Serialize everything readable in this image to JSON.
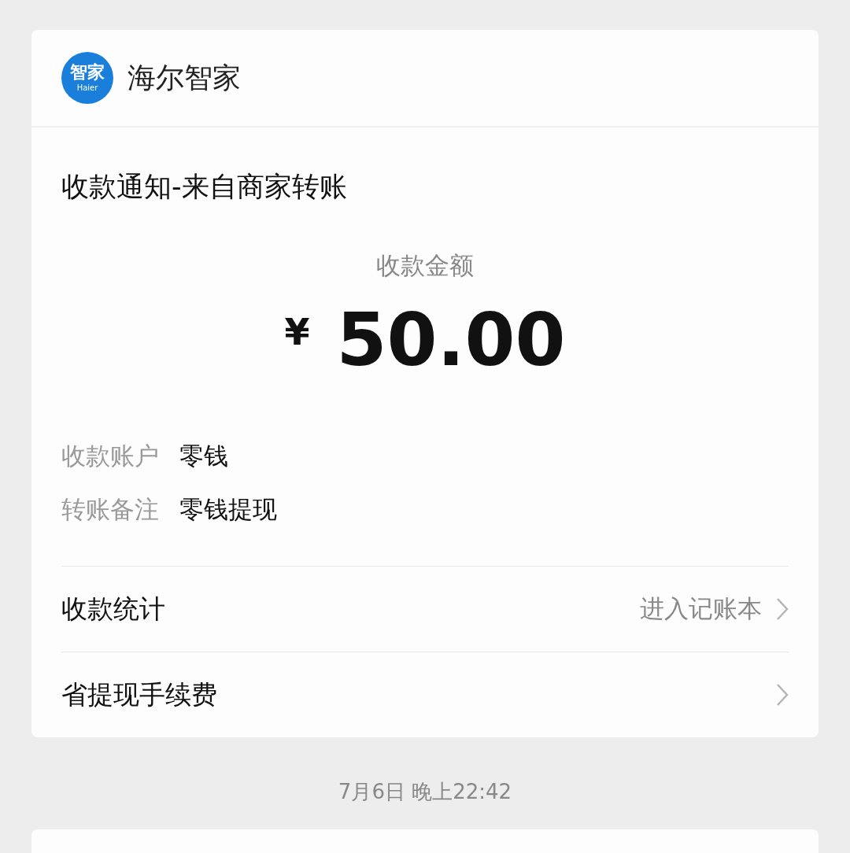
{
  "message": {
    "app": {
      "logo_text": "智家",
      "logo_subtext": "Haier",
      "name": "海尔智家"
    },
    "title": "收款通知-来自商家转账",
    "amount_label": "收款金额",
    "currency": "¥",
    "amount": "50.00",
    "details": [
      {
        "label": "收款账户",
        "value": "零钱"
      },
      {
        "label": "转账备注",
        "value": "零钱提现"
      }
    ],
    "links": [
      {
        "label": "收款统计",
        "hint": "进入记账本"
      },
      {
        "label": "省提现手续费"
      }
    ]
  },
  "next_timestamp": "7月6日 晚上22:42"
}
